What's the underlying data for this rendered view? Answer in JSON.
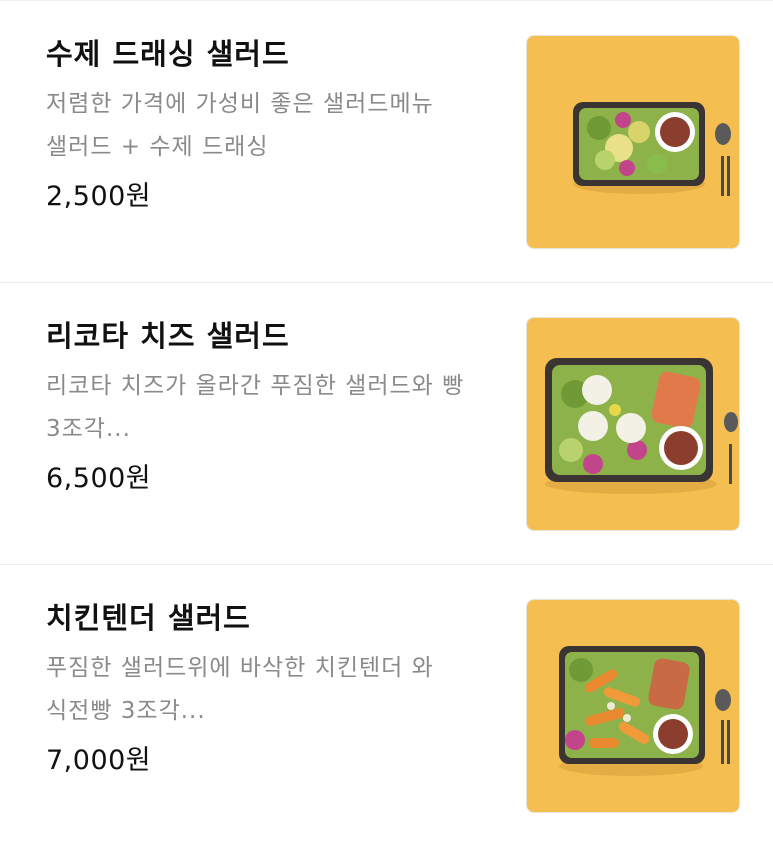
{
  "menu": {
    "items": [
      {
        "name": "수제 드래싱 샐러드",
        "desc_lines": [
          "저렴한 가격에 가성비 좋은 샐러드메뉴",
          "샐러드 + 수제 드래싱"
        ],
        "price": "2,500원",
        "photo_icon": "salad-bowl-icon"
      },
      {
        "name": "리코타 치즈 샐러드",
        "desc_lines": [
          "리코타 치즈가 올라간 푸짐한 샐러드와 빵",
          "3조각..."
        ],
        "price": "6,500원",
        "photo_icon": "salad-bowl-icon"
      },
      {
        "name": "치킨텐더 샐러드",
        "desc_lines": [
          "푸짐한 샐러드위에 바삭한 치킨텐더 와",
          "식전빵 3조각..."
        ],
        "price": "7,000원",
        "photo_icon": "salad-bowl-icon"
      }
    ]
  },
  "colors": {
    "photo_background": "#f4bf50",
    "title_text": "#111111",
    "description_text": "#8a8a8a",
    "divider": "#ececec"
  }
}
